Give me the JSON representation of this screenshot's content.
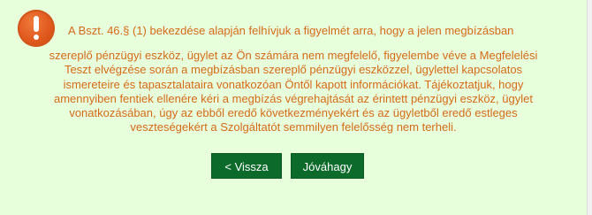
{
  "notice": {
    "icon": "exclamation-warning-icon",
    "accent_color": "#e0581c",
    "text_color": "#d56a1a",
    "background": "#e8ffdc",
    "first_line": "A Bszt. 46.§ (1) bekezdése alapján felhívjuk a figyelmét arra, hogy a jelen megbízásban",
    "lines": [
      "szereplő pénzügyi eszköz, ügylet az Ön számára nem megfelelő, figyelembe véve a Megfelelési",
      "Teszt elvégzése során a megbízásban szereplő pénzügyi eszközzel, ügylettel kapcsolatos",
      "ismereteire és tapasztalataira vonatkozóan Öntől kapott információkat. Tájékoztatjuk, hogy",
      "amennyiben fentiek ellenére kéri a megbízás végrehajtását az érintett pénzügyi eszköz, ügylet",
      "vonatkozásában, úgy az ebből eredő következményekért és az ügyletből eredő estleges",
      "veszteségekért a Szolgáltatót semmilyen felelősség nem terheli."
    ]
  },
  "actions": {
    "back_label": "< Vissza",
    "confirm_label": "Jóváhagy",
    "button_color": "#0c6a2a"
  }
}
